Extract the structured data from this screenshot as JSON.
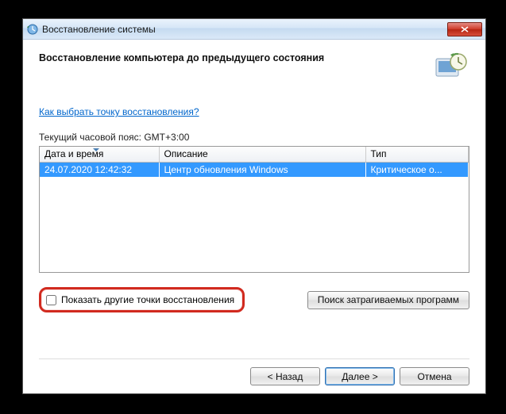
{
  "window": {
    "title": "Восстановление системы"
  },
  "wizard": {
    "heading": "Восстановление компьютера до предыдущего состояния"
  },
  "help_link": "Как выбрать точку восстановления?",
  "timezone_label": "Текущий часовой пояс: GMT+3:00",
  "columns": {
    "datetime": "Дата и время",
    "description": "Описание",
    "type": "Тип"
  },
  "rows": [
    {
      "datetime": "24.07.2020 12:42:32",
      "description": "Центр обновления Windows",
      "type": "Критическое о..."
    }
  ],
  "show_more": {
    "label": "Показать другие точки восстановления"
  },
  "buttons": {
    "scan": "Поиск затрагиваемых программ",
    "back": "< Назад",
    "next": "Далее >",
    "cancel": "Отмена"
  }
}
